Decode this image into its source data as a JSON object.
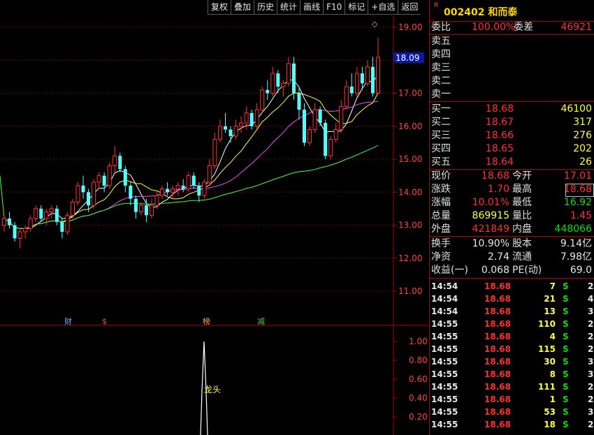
{
  "toolbar": {
    "items": [
      "复权",
      "叠加",
      "历史",
      "统计",
      "画线",
      "F10",
      "标记",
      "+自选",
      "返回"
    ]
  },
  "stock": {
    "code_name": "002402 和而泰",
    "r_mark": "R"
  },
  "chart": {
    "price_ticks": [
      "19.00",
      "18.00",
      "17.00",
      "16.00",
      "15.00",
      "14.00",
      "13.00",
      "12.00",
      "11.00"
    ],
    "current_price_label": "18.09",
    "indicator_ticks": [
      "1.00",
      "0.80",
      "0.60",
      "0.40",
      "0.20"
    ],
    "event_markers": [
      {
        "label": "财",
        "color": "#6aa8ff"
      },
      {
        "label": "$",
        "color": "#ff4040"
      },
      {
        "label": "榜",
        "color": "#ffa040"
      },
      {
        "label": "减",
        "color": "#40d040"
      }
    ],
    "indicator_label": "龙头",
    "diamond": "◇",
    "colors": {
      "up": "#ff3030",
      "down": "#54ffff",
      "ma5": "#ffffff",
      "ma10": "#ffff40",
      "ma20": "#ff40ff",
      "ma60": "#40ff40",
      "grid": "#b00000"
    }
  },
  "chart_data": {
    "type": "candlestick",
    "price_axis": [
      11.0,
      19.0
    ],
    "candles": [
      [
        13.0,
        13.3,
        12.8,
        13.2
      ],
      [
        13.2,
        13.4,
        12.9,
        13.0
      ],
      [
        13.0,
        13.1,
        12.5,
        12.6
      ],
      [
        12.6,
        12.9,
        12.3,
        12.8
      ],
      [
        12.8,
        13.0,
        12.6,
        12.9
      ],
      [
        12.9,
        13.3,
        12.8,
        13.2
      ],
      [
        13.2,
        13.6,
        13.1,
        13.5
      ],
      [
        13.5,
        13.6,
        13.1,
        13.2
      ],
      [
        13.2,
        13.5,
        13.0,
        13.4
      ],
      [
        13.4,
        13.6,
        13.2,
        13.5
      ],
      [
        13.5,
        13.6,
        13.0,
        13.1
      ],
      [
        13.1,
        13.2,
        12.6,
        12.8
      ],
      [
        12.8,
        13.4,
        12.7,
        13.3
      ],
      [
        13.3,
        13.8,
        13.2,
        13.7
      ],
      [
        13.7,
        14.3,
        13.6,
        14.2
      ],
      [
        14.2,
        14.5,
        13.8,
        14.0
      ],
      [
        14.0,
        14.1,
        13.4,
        13.6
      ],
      [
        13.6,
        14.4,
        13.5,
        14.3
      ],
      [
        14.3,
        14.6,
        14.1,
        14.5
      ],
      [
        14.5,
        14.6,
        14.0,
        14.2
      ],
      [
        14.2,
        14.9,
        14.1,
        14.8
      ],
      [
        14.8,
        15.4,
        14.6,
        15.1
      ],
      [
        15.1,
        15.2,
        14.6,
        14.7
      ],
      [
        14.7,
        14.8,
        14.0,
        14.2
      ],
      [
        14.2,
        14.3,
        13.6,
        13.8
      ],
      [
        13.8,
        13.9,
        13.2,
        13.4
      ],
      [
        13.4,
        13.7,
        13.3,
        13.6
      ],
      [
        13.6,
        13.8,
        13.1,
        13.3
      ],
      [
        13.3,
        13.8,
        13.2,
        13.6
      ],
      [
        13.6,
        14.0,
        13.5,
        13.9
      ],
      [
        13.9,
        14.2,
        13.8,
        14.1
      ],
      [
        14.1,
        14.3,
        13.9,
        14.0
      ],
      [
        14.0,
        14.2,
        13.8,
        14.1
      ],
      [
        14.1,
        14.3,
        13.9,
        14.2
      ],
      [
        14.2,
        14.4,
        14.0,
        14.1
      ],
      [
        14.1,
        14.6,
        14.0,
        14.5
      ],
      [
        14.5,
        14.6,
        14.1,
        14.2
      ],
      [
        14.2,
        14.3,
        13.7,
        13.9
      ],
      [
        13.9,
        14.4,
        13.8,
        14.3
      ],
      [
        14.3,
        15.0,
        14.2,
        14.8
      ],
      [
        14.8,
        15.8,
        14.7,
        15.6
      ],
      [
        15.6,
        16.2,
        15.5,
        16.0
      ],
      [
        16.0,
        16.4,
        15.8,
        15.9
      ],
      [
        15.9,
        16.0,
        15.5,
        15.7
      ],
      [
        15.7,
        16.2,
        15.6,
        16.0
      ],
      [
        16.0,
        16.3,
        15.8,
        16.1
      ],
      [
        16.1,
        16.6,
        15.9,
        16.4
      ],
      [
        16.4,
        16.5,
        15.9,
        16.0
      ],
      [
        16.0,
        16.7,
        15.9,
        16.5
      ],
      [
        16.5,
        17.2,
        16.4,
        17.1
      ],
      [
        17.1,
        17.4,
        16.8,
        17.0
      ],
      [
        17.0,
        17.8,
        16.9,
        17.6
      ],
      [
        17.6,
        17.7,
        17.0,
        17.2
      ],
      [
        17.2,
        17.4,
        16.9,
        17.3
      ],
      [
        17.3,
        18.1,
        17.2,
        17.9
      ],
      [
        17.9,
        18.1,
        16.8,
        17.0
      ],
      [
        17.0,
        17.2,
        16.2,
        16.5
      ],
      [
        16.5,
        16.7,
        15.4,
        15.5
      ],
      [
        15.5,
        16.0,
        15.4,
        15.9
      ],
      [
        15.9,
        16.7,
        15.8,
        16.5
      ],
      [
        16.5,
        16.6,
        16.0,
        16.1
      ],
      [
        16.1,
        16.2,
        15.0,
        15.1
      ],
      [
        15.1,
        15.7,
        15.0,
        15.6
      ],
      [
        15.6,
        16.1,
        15.5,
        15.9
      ],
      [
        15.9,
        16.8,
        15.8,
        16.6
      ],
      [
        16.6,
        17.4,
        16.5,
        17.2
      ],
      [
        17.2,
        17.6,
        16.9,
        17.0
      ],
      [
        17.0,
        17.8,
        16.9,
        17.6
      ],
      [
        17.6,
        17.8,
        17.1,
        17.3
      ],
      [
        17.3,
        18.0,
        17.2,
        17.8
      ],
      [
        17.8,
        18.1,
        16.9,
        17.0
      ],
      [
        17.0,
        18.68,
        17.0,
        18.09
      ]
    ]
  },
  "quote": {
    "weibi": {
      "label": "委比",
      "value": "100.00%",
      "label2": "委差",
      "value2": "46921"
    },
    "sells": [
      {
        "label": "卖五"
      },
      {
        "label": "卖四"
      },
      {
        "label": "卖三"
      },
      {
        "label": "卖二"
      },
      {
        "label": "卖一"
      }
    ],
    "buys": [
      {
        "label": "买一",
        "price": "18.68",
        "vol": "46100"
      },
      {
        "label": "买二",
        "price": "18.67",
        "vol": "317"
      },
      {
        "label": "买三",
        "price": "18.66",
        "vol": "276"
      },
      {
        "label": "买四",
        "price": "18.65",
        "vol": "202"
      },
      {
        "label": "买五",
        "price": "18.64",
        "vol": "26"
      }
    ],
    "stats": [
      {
        "l1": "现价",
        "v1": "18.68",
        "c1": "red",
        "l2": "今开",
        "v2": "17.01",
        "c2": "red"
      },
      {
        "l1": "涨跌",
        "v1": "1.70",
        "c1": "red",
        "l2": "最高",
        "v2": "18.68",
        "c2": "red"
      },
      {
        "l1": "涨幅",
        "v1": "10.01%",
        "c1": "red",
        "l2": "最低",
        "v2": "16.92",
        "c2": "green"
      },
      {
        "l1": "总量",
        "v1": "869915",
        "c1": "yellow",
        "l2": "量比",
        "v2": "1.45",
        "c2": "red"
      },
      {
        "l1": "外盘",
        "v1": "421849",
        "c1": "red",
        "l2": "内盘",
        "v2": "448066",
        "c2": "green"
      }
    ],
    "stats2": [
      {
        "l1": "换手",
        "v1": "10.90%",
        "l2": "股本",
        "v2": "9.14亿"
      },
      {
        "l1": "净资",
        "v1": "2.74",
        "l2": "流通",
        "v2": "7.98亿"
      },
      {
        "l1": "收益(一)",
        "v1": "0.068",
        "l2": "PE(动)",
        "v2": "69.0"
      }
    ],
    "ticks": [
      {
        "t": "14:54",
        "p": "18.68",
        "v": "7",
        "s": "S",
        "n": "2"
      },
      {
        "t": "14:54",
        "p": "18.68",
        "v": "21",
        "s": "S",
        "n": "4"
      },
      {
        "t": "14:54",
        "p": "18.68",
        "v": "13",
        "s": "S",
        "n": "3"
      },
      {
        "t": "14:55",
        "p": "18.68",
        "v": "110",
        "s": "S",
        "n": "2"
      },
      {
        "t": "14:55",
        "p": "18.68",
        "v": "4",
        "s": "S",
        "n": "2"
      },
      {
        "t": "14:55",
        "p": "18.68",
        "v": "115",
        "s": "S",
        "n": "2"
      },
      {
        "t": "14:55",
        "p": "18.68",
        "v": "30",
        "s": "S",
        "n": "3"
      },
      {
        "t": "14:55",
        "p": "18.68",
        "v": "8",
        "s": "S",
        "n": "3"
      },
      {
        "t": "14:55",
        "p": "18.68",
        "v": "111",
        "s": "S",
        "n": "2"
      },
      {
        "t": "14:55",
        "p": "18.68",
        "v": "1",
        "s": "S",
        "n": "2"
      },
      {
        "t": "14:55",
        "p": "18.68",
        "v": "53",
        "s": "S",
        "n": "3"
      },
      {
        "t": "14:55",
        "p": "18.68",
        "v": "18",
        "s": "S",
        "n": "2"
      }
    ]
  }
}
